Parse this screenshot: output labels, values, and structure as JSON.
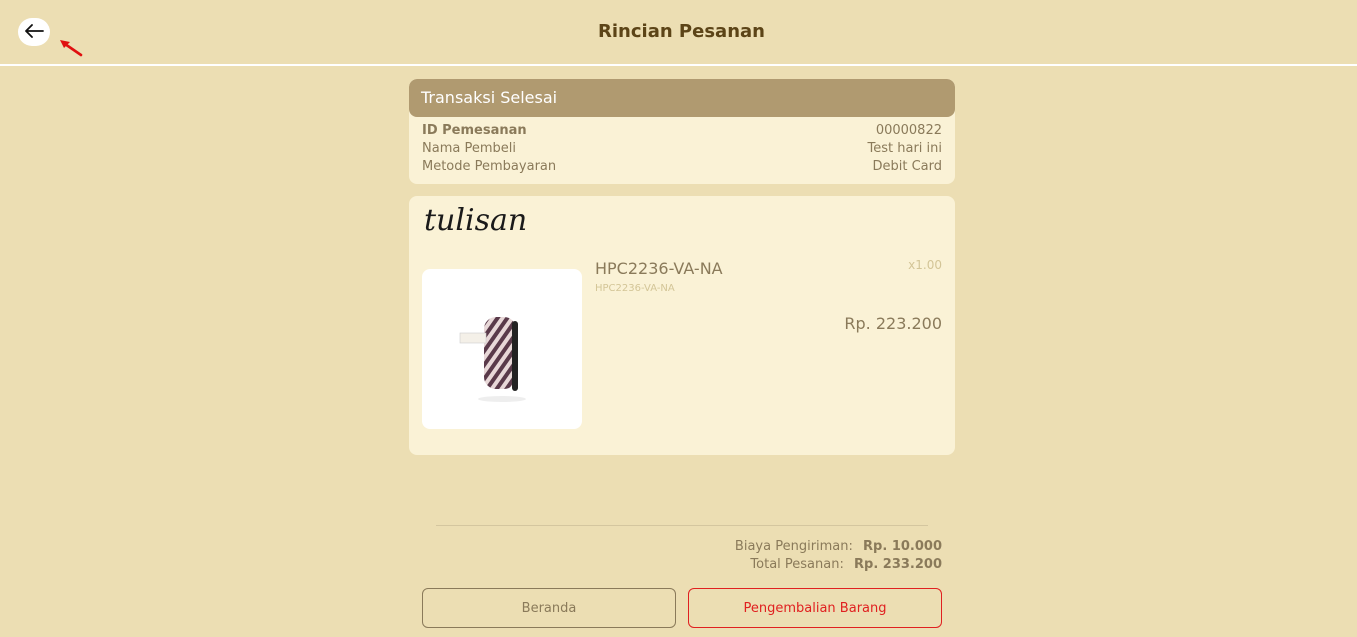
{
  "header": {
    "title": "Rincian Pesanan",
    "back_icon": "arrow-left-icon"
  },
  "order": {
    "status": "Transaksi Selesai",
    "rows": [
      {
        "label": "ID Pemesanan",
        "value": "00000822"
      },
      {
        "label": "Nama Pembeli",
        "value": "Test hari ini"
      },
      {
        "label": "Metode Pembayaran",
        "value": "Debit Card"
      }
    ]
  },
  "product": {
    "brand": "tulisan",
    "name": "HPC2236-VA-NA",
    "sku": "HPC2236-VA-NA",
    "qty": "x1.00",
    "price": "Rp. 223.200"
  },
  "summary": {
    "shipping_label": "Biaya Pengiriman:",
    "shipping_value": "Rp. 10.000",
    "total_label": "Total Pesanan:",
    "total_value": "Rp. 233.200"
  },
  "actions": {
    "home_label": "Beranda",
    "return_label": "Pengembalian Barang"
  },
  "colors": {
    "background": "#ecdeb3",
    "card": "#faf2d6",
    "status_bar": "#b09a70",
    "title": "#5c4417",
    "danger": "#e02020"
  }
}
